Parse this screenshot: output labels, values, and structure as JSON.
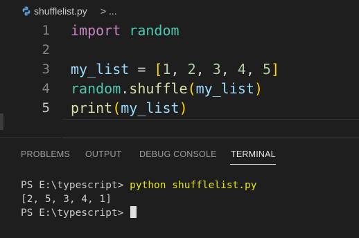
{
  "breadcrumb": {
    "file": "shufflelist.py",
    "separator": ">",
    "more": "..."
  },
  "editor": {
    "lines": [
      {
        "number": "1",
        "tokens": [
          {
            "text": "import",
            "cls": "kw"
          },
          {
            "text": " ",
            "cls": "op"
          },
          {
            "text": "random",
            "cls": "mod"
          }
        ]
      },
      {
        "number": "2",
        "tokens": []
      },
      {
        "number": "3",
        "tokens": [
          {
            "text": "my_list",
            "cls": "var"
          },
          {
            "text": " = ",
            "cls": "op"
          },
          {
            "text": "[",
            "cls": "brk"
          },
          {
            "text": "1",
            "cls": "num"
          },
          {
            "text": ", ",
            "cls": "op"
          },
          {
            "text": "2",
            "cls": "num"
          },
          {
            "text": ", ",
            "cls": "op"
          },
          {
            "text": "3",
            "cls": "num"
          },
          {
            "text": ", ",
            "cls": "op"
          },
          {
            "text": "4",
            "cls": "num"
          },
          {
            "text": ", ",
            "cls": "op"
          },
          {
            "text": "5",
            "cls": "num"
          },
          {
            "text": "]",
            "cls": "brk"
          }
        ]
      },
      {
        "number": "4",
        "tokens": [
          {
            "text": "random",
            "cls": "mod"
          },
          {
            "text": ".",
            "cls": "op"
          },
          {
            "text": "shuffle",
            "cls": "fn"
          },
          {
            "text": "(",
            "cls": "brk"
          },
          {
            "text": "my_list",
            "cls": "var"
          },
          {
            "text": ")",
            "cls": "brk"
          }
        ]
      },
      {
        "number": "5",
        "tokens": [
          {
            "text": "print",
            "cls": "fn"
          },
          {
            "text": "(",
            "cls": "brk"
          },
          {
            "text": "my_list",
            "cls": "var"
          },
          {
            "text": ")",
            "cls": "brk"
          }
        ]
      }
    ]
  },
  "panel": {
    "tabs": [
      "PROBLEMS",
      "OUTPUT",
      "DEBUG CONSOLE",
      "TERMINAL"
    ],
    "active_tab": "TERMINAL"
  },
  "terminal": {
    "prompt": "PS E:\\typescript> ",
    "command": "python shufflelist.py",
    "output": "[2, 5, 3, 4, 1]",
    "prompt2": "PS E:\\typescript> "
  },
  "colors": {
    "keyword": "#c586c0",
    "module": "#4ec9b0",
    "variable": "#9cdcfe",
    "number": "#b5cea8",
    "function": "#dcdcaa",
    "bracket": "#ffd700",
    "terminal_command": "#e5e510"
  },
  "icons": {
    "file_icon": "python-file-icon"
  }
}
